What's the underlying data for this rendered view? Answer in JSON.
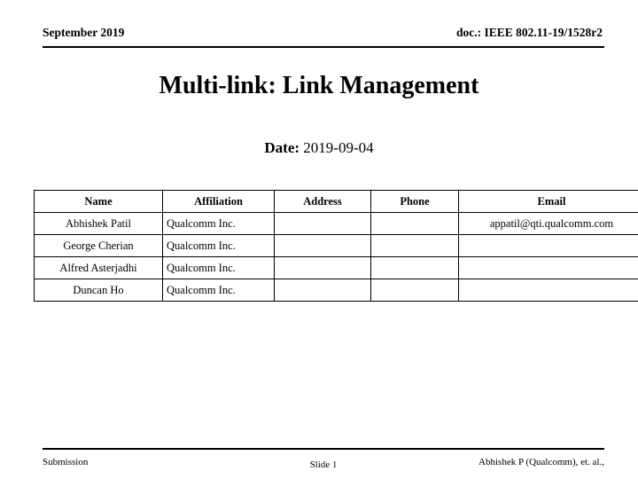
{
  "header": {
    "left": "September 2019",
    "right": "doc.: IEEE 802.11-19/1528r2"
  },
  "title": "Multi-link: Link Management",
  "date": {
    "label": "Date:",
    "value": "2019-09-04"
  },
  "authors_table": {
    "columns": [
      "Name",
      "Affiliation",
      "Address",
      "Phone",
      "Email"
    ],
    "rows": [
      {
        "name": "Abhishek Patil",
        "affiliation": "Qualcomm Inc.",
        "address": "",
        "phone": "",
        "email": "appatil@qti.qualcomm.com"
      },
      {
        "name": "George Cherian",
        "affiliation": "Qualcomm Inc.",
        "address": "",
        "phone": "",
        "email": ""
      },
      {
        "name": "Alfred Asterjadhi",
        "affiliation": "Qualcomm Inc.",
        "address": "",
        "phone": "",
        "email": ""
      },
      {
        "name": "Duncan Ho",
        "affiliation": "Qualcomm Inc.",
        "address": "",
        "phone": "",
        "email": ""
      }
    ]
  },
  "footer": {
    "left": "Submission",
    "center": "Slide 1",
    "right": "Abhishek P (Qualcomm), et. al.,"
  },
  "colors": {
    "text": "#000000",
    "background": "#ffffff",
    "rule": "#000000"
  }
}
